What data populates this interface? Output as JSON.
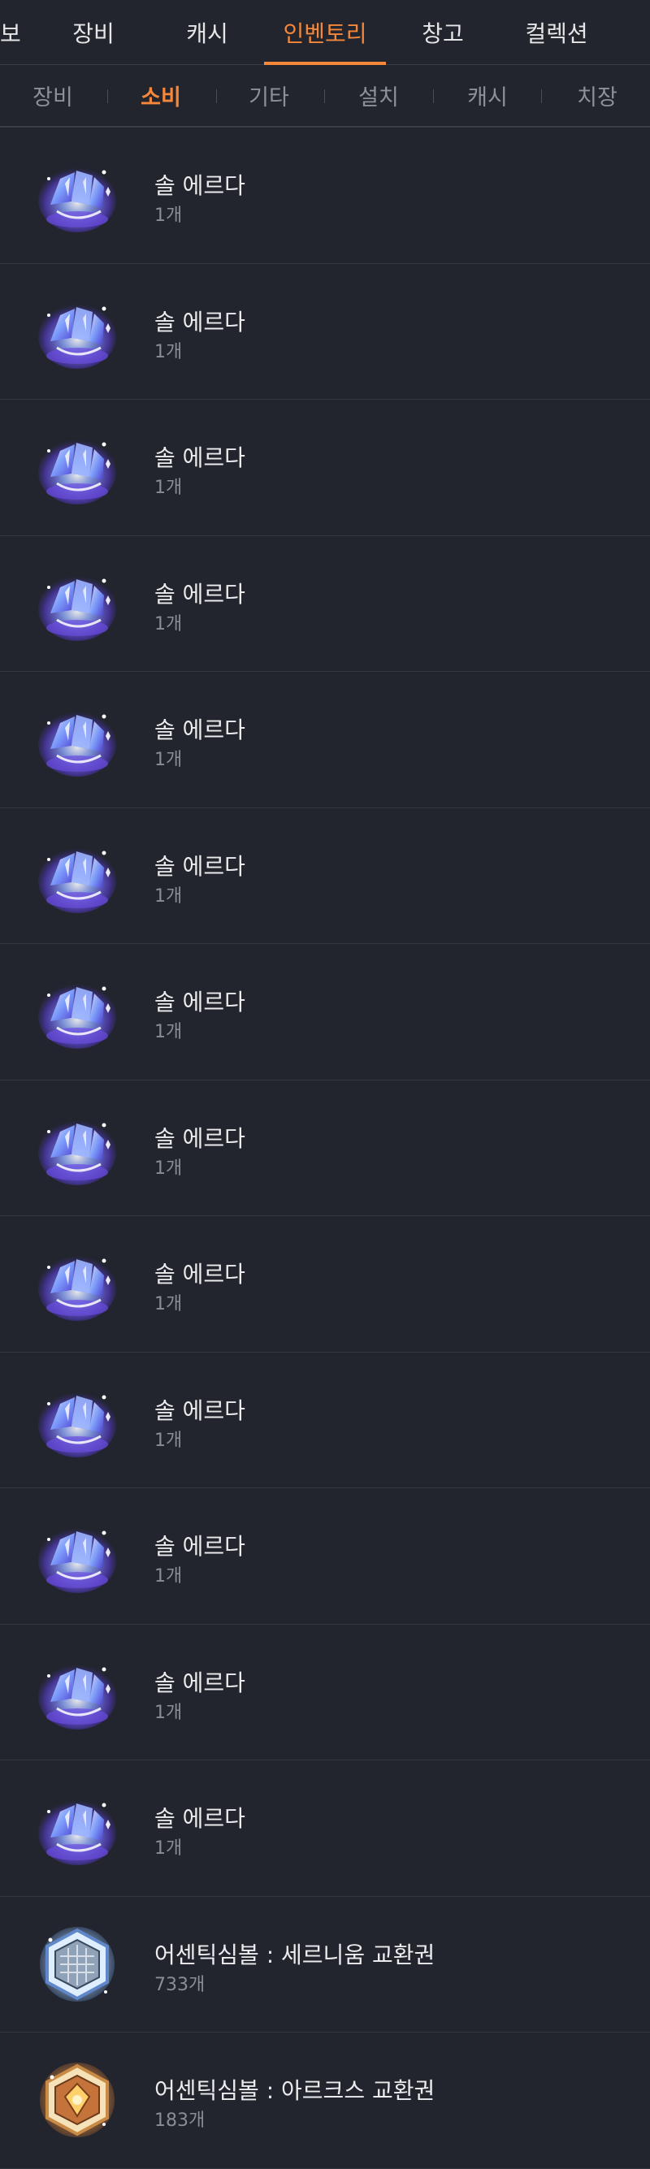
{
  "top_tabs": [
    {
      "label": "보"
    },
    {
      "label": "장비"
    },
    {
      "label": "캐시"
    },
    {
      "label": "인벤토리"
    },
    {
      "label": "창고"
    },
    {
      "label": "컬렉션"
    }
  ],
  "top_active": "인벤토리",
  "sub_tabs": [
    {
      "label": "장비"
    },
    {
      "label": "소비"
    },
    {
      "label": "기타"
    },
    {
      "label": "설치"
    },
    {
      "label": "캐시"
    },
    {
      "label": "치장"
    }
  ],
  "sub_active": "소비",
  "items": [
    {
      "name": "솔 에르다",
      "qty": "1개",
      "icon": "sol-erda-icon"
    },
    {
      "name": "솔 에르다",
      "qty": "1개",
      "icon": "sol-erda-icon"
    },
    {
      "name": "솔 에르다",
      "qty": "1개",
      "icon": "sol-erda-icon"
    },
    {
      "name": "솔 에르다",
      "qty": "1개",
      "icon": "sol-erda-icon"
    },
    {
      "name": "솔 에르다",
      "qty": "1개",
      "icon": "sol-erda-icon"
    },
    {
      "name": "솔 에르다",
      "qty": "1개",
      "icon": "sol-erda-icon"
    },
    {
      "name": "솔 에르다",
      "qty": "1개",
      "icon": "sol-erda-icon"
    },
    {
      "name": "솔 에르다",
      "qty": "1개",
      "icon": "sol-erda-icon"
    },
    {
      "name": "솔 에르다",
      "qty": "1개",
      "icon": "sol-erda-icon"
    },
    {
      "name": "솔 에르다",
      "qty": "1개",
      "icon": "sol-erda-icon"
    },
    {
      "name": "솔 에르다",
      "qty": "1개",
      "icon": "sol-erda-icon"
    },
    {
      "name": "솔 에르다",
      "qty": "1개",
      "icon": "sol-erda-icon"
    },
    {
      "name": "솔 에르다",
      "qty": "1개",
      "icon": "sol-erda-icon"
    },
    {
      "name": "어센틱심볼 : 세르니움 교환권",
      "qty": "733개",
      "icon": "cernium-symbol-voucher-icon"
    },
    {
      "name": "어센틱심볼 : 아르크스 교환권",
      "qty": "183개",
      "icon": "arcus-symbol-voucher-icon"
    }
  ],
  "colors": {
    "background": "#22252d",
    "accent": "#f5883a",
    "divider": "#353841",
    "secondary_text": "#8a8d95"
  }
}
